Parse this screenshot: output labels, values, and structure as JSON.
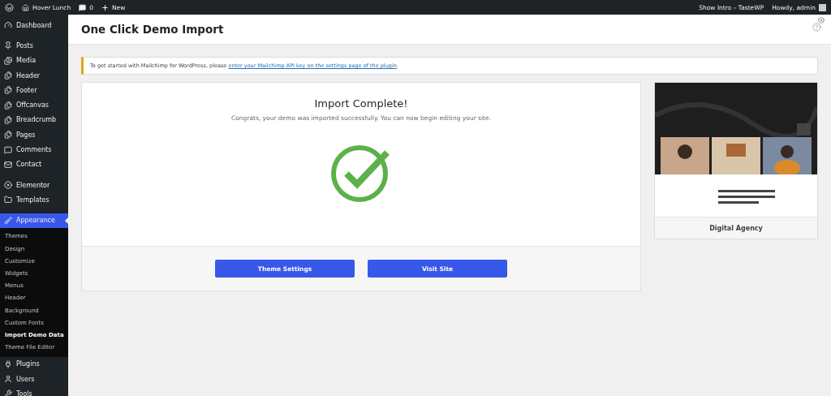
{
  "admin_bar": {
    "site": "Hover Lunch",
    "comments": "0",
    "new": "New",
    "intro": "Show Intro – TasteWP",
    "howdy": "Howdy, admin"
  },
  "sidebar": {
    "groups": [
      [
        {
          "label": "Dashboard",
          "selected": false
        }
      ],
      [
        {
          "label": "Posts",
          "selected": false
        },
        {
          "label": "Media",
          "selected": false
        },
        {
          "label": "Header",
          "selected": false
        },
        {
          "label": "Footer",
          "selected": false
        },
        {
          "label": "Offcanvas",
          "selected": false
        },
        {
          "label": "Breadcrumb",
          "selected": false
        },
        {
          "label": "Pages",
          "selected": false
        },
        {
          "label": "Comments",
          "selected": false
        },
        {
          "label": "Contact",
          "selected": false
        }
      ],
      [
        {
          "label": "Elementor",
          "selected": false
        },
        {
          "label": "Templates",
          "selected": false
        }
      ],
      [
        {
          "label": "Appearance",
          "selected": true,
          "children": [
            {
              "label": "Themes",
              "selected": false
            },
            {
              "label": "Design",
              "selected": false
            },
            {
              "label": "Customize",
              "selected": false
            },
            {
              "label": "Widgets",
              "selected": false
            },
            {
              "label": "Menus",
              "selected": false
            },
            {
              "label": "Header",
              "selected": false
            },
            {
              "label": "Background",
              "selected": false
            },
            {
              "label": "Custom Fonts",
              "selected": false
            },
            {
              "label": "Import Demo Data",
              "selected": true
            },
            {
              "label": "Theme File Editor",
              "selected": false
            }
          ]
        },
        {
          "label": "Plugins",
          "selected": false
        },
        {
          "label": "Users",
          "selected": false
        },
        {
          "label": "Tools",
          "selected": false
        }
      ]
    ]
  },
  "page_title": "One Click Demo Import",
  "notice": {
    "text": "To get started with Mailchimp for WordPress, please ",
    "link": "enter your Mailchimp API key on the settings page of the plugin",
    "after": "."
  },
  "import": {
    "title": "Import Complete!",
    "message": "Congrats, your demo was imported successfully. You can now begin editing your site.",
    "buttons": [
      "Theme Settings",
      "Visit Site"
    ]
  },
  "demo": {
    "kind": "picture",
    "name": "Digital Agency"
  }
}
